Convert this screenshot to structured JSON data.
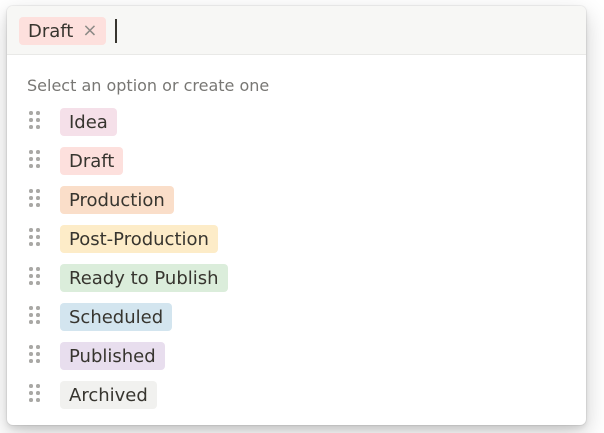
{
  "input": {
    "selected_tag": {
      "label": "Draft",
      "color": "#fde0dd"
    },
    "remove_glyph": "×"
  },
  "hint": "Select an option or create one",
  "options": [
    {
      "label": "Idea",
      "color": "#f5e0e9"
    },
    {
      "label": "Draft",
      "color": "#fde0dd"
    },
    {
      "label": "Production",
      "color": "#fadec9"
    },
    {
      "label": "Post-Production",
      "color": "#fdecc8"
    },
    {
      "label": "Ready to Publish",
      "color": "#dbeddb"
    },
    {
      "label": "Scheduled",
      "color": "#d3e5ef"
    },
    {
      "label": "Published",
      "color": "#e8deee"
    },
    {
      "label": "Archived",
      "color": "#f1f1ef"
    }
  ],
  "icons": {
    "drag_handle": "drag-handle-icon",
    "remove": "close-icon"
  }
}
